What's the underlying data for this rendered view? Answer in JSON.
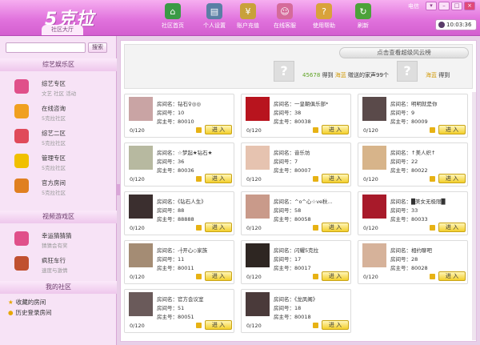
{
  "app": {
    "logo_text": "5克拉",
    "tab": "社区大厅"
  },
  "nav": [
    {
      "label": "社区首页",
      "icon": "home-icon",
      "color": "#3a9a45"
    },
    {
      "label": "个人设置",
      "icon": "profile-card-icon",
      "color": "#5a7fa5"
    },
    {
      "label": "账户充值",
      "icon": "money-icon",
      "color": "#c8a13a"
    },
    {
      "label": "在线客服",
      "icon": "customer-service-icon",
      "color": "#d56b9a"
    },
    {
      "label": "使用帮助",
      "icon": "help-book-icon",
      "color": "#d9a23a"
    },
    {
      "label": "刷新",
      "icon": "refresh-icon",
      "color": "#4ca23a"
    }
  ],
  "window": {
    "network_label": "电信",
    "time": "10:03:36"
  },
  "sidebar": {
    "search_placeholder": "",
    "search_button": "搜索",
    "section1": "综艺娱乐区",
    "items1": [
      {
        "title": "综艺专区",
        "sub": "文艺  社区  活动",
        "icon": "variety-icon"
      },
      {
        "title": "在线咨询",
        "sub": "5克拉社区",
        "icon": "consult-icon"
      },
      {
        "title": "综艺二区",
        "sub": "5克拉社区",
        "icon": "variety2-icon"
      },
      {
        "title": "管理专区",
        "sub": "5克拉社区",
        "icon": "admin-icon"
      },
      {
        "title": "官方房间",
        "sub": "5克拉社区",
        "icon": "official-icon"
      }
    ],
    "section2": "视频游戏区",
    "items2": [
      {
        "title": "幸运猜猜猜",
        "sub": "猜猜会有奖",
        "icon": "lucky-guess-icon"
      },
      {
        "title": "疯狂车行",
        "sub": "速度与激情",
        "icon": "crazy-car-icon"
      }
    ],
    "section3": "我的社区",
    "my": [
      {
        "label": "收藏的房间",
        "icon": "star-icon"
      },
      {
        "label": "历史登录房间",
        "icon": "history-icon"
      }
    ]
  },
  "banner": {
    "button": "点击查看超级风云榜",
    "num": "45678",
    "text_got": "得到",
    "name": "海蓝",
    "text_rest": "赠送的家声99个",
    "num2": "",
    "name2": "海蓝",
    "text_got2": "得到"
  },
  "labels": {
    "room_name": "房间名：",
    "room_no": "房间号：",
    "owner_no": "房主号：",
    "enter": "进 入"
  },
  "rooms": [
    {
      "name": "钻石♀◎◎",
      "no": "10",
      "owner": "80010",
      "count": "0/120",
      "photo": "#c9a4a4"
    },
    {
      "name": "一皇朝俱乐部*",
      "no": "38",
      "owner": "80038",
      "count": "0/120",
      "photo": "#b8141e"
    },
    {
      "name": "明明就是你",
      "no": "9",
      "owner": "80009",
      "count": "0/120",
      "photo": "#5a4a4a"
    },
    {
      "name": "☆梦起★钻石★",
      "no": "36",
      "owner": "80036",
      "count": "0/120",
      "photo": "#b7b9a0"
    },
    {
      "name": "音乐坊",
      "no": "7",
      "owner": "80007",
      "count": "0/120",
      "photo": "#e6c3b0"
    },
    {
      "name": "↑美人织↑",
      "no": "22",
      "owner": "80022",
      "count": "0/120",
      "photo": "#d7b48a"
    },
    {
      "name": "《钻石人生》",
      "no": "88",
      "owner": "88888",
      "count": "0/120",
      "photo": "#3b2f2f"
    },
    {
      "name": "^o^心☆ve秋...",
      "no": "58",
      "owner": "80058",
      "count": "0/120",
      "photo": "#c99a8a"
    },
    {
      "name": "█美女无极限█",
      "no": "33",
      "owner": "80033",
      "count": "0/120",
      "photo": "#a81a2a"
    },
    {
      "name": "-┼开心◇家族",
      "no": "11",
      "owner": "80011",
      "count": "0/120",
      "photo": "#a48c74"
    },
    {
      "name": "闪耀5克拉",
      "no": "17",
      "owner": "80017",
      "count": "0/120",
      "photo": "#2e2622"
    },
    {
      "name": "相约聊吧",
      "no": "28",
      "owner": "80028",
      "count": "0/120",
      "photo": "#d6b29a"
    },
    {
      "name": "官方会议室",
      "no": "51",
      "owner": "80051",
      "count": "0/120",
      "photo": "#6a5a5a"
    },
    {
      "name": "《龙凤阁》",
      "no": "18",
      "owner": "80018",
      "count": "0/120",
      "photo": "#4a3a3a"
    }
  ]
}
